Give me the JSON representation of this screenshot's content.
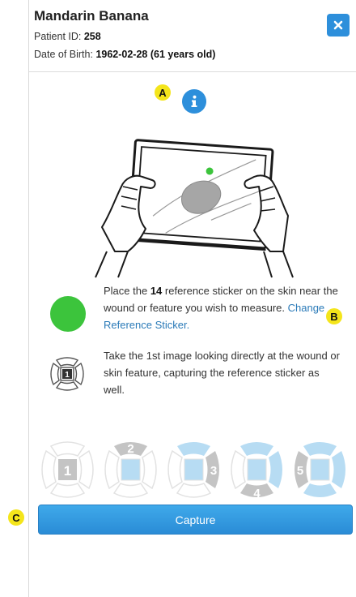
{
  "patient": {
    "name": "Mandarin Banana",
    "id_label": "Patient ID:",
    "id": "258",
    "dob_label": "Date of Birth:",
    "dob": "1962-02-28 (61 years old)"
  },
  "icons": {
    "close": "close-icon",
    "info": "info-icon",
    "sticker": "green-circle-icon",
    "step": "camera-position-icon"
  },
  "markers": {
    "a": "A",
    "b": "B",
    "c": "C"
  },
  "instructions": {
    "sticker_pre": "Place the ",
    "sticker_count": "14",
    "sticker_post": " reference sticker on the skin near the wound or feature you wish to measure. ",
    "change_link": "Change Reference Sticker.",
    "first_image": "Take the 1st image looking directly at the wound or skin feature, capturing the reference sticker as well."
  },
  "progress_steps": [
    {
      "label": "1"
    },
    {
      "label": "2"
    },
    {
      "label": "3"
    },
    {
      "label": "4"
    },
    {
      "label": "5"
    }
  ],
  "capture_label": "Capture",
  "colors": {
    "primary": "#2d8fdb",
    "marker": "#f4e51b",
    "sticker": "#3cc43c",
    "step_highlight": "#b7dcf3",
    "step_grey": "#c4c4c4"
  }
}
